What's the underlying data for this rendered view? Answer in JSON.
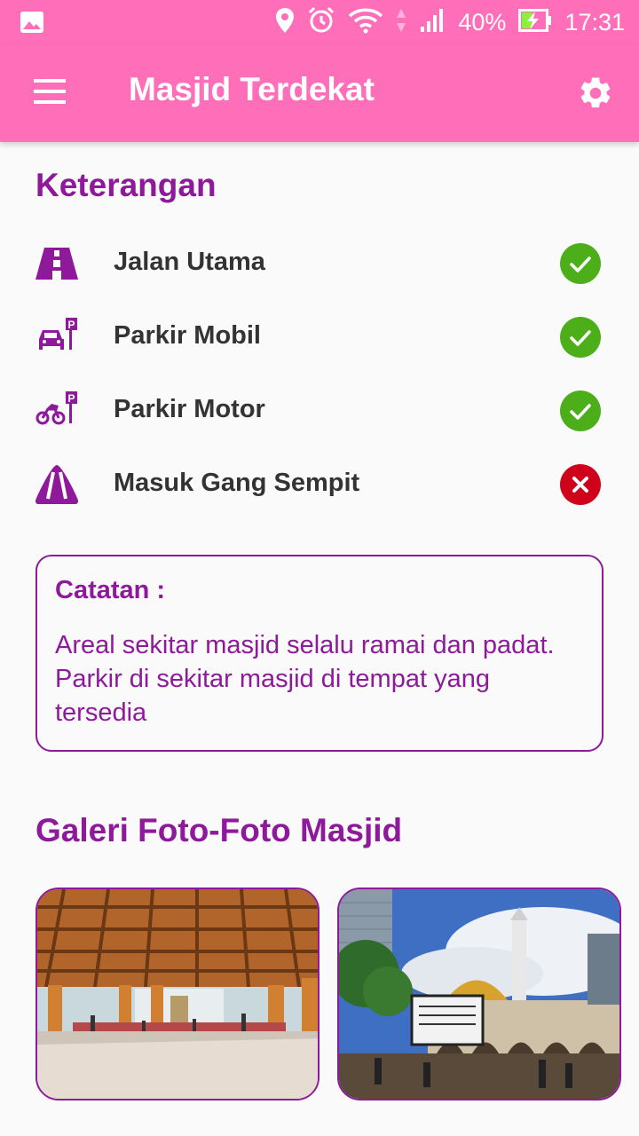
{
  "status_bar": {
    "battery": "40%",
    "time": "17:31"
  },
  "app_bar": {
    "title": "Masjid Terdekat",
    "menu_icon": "hamburger-menu-icon",
    "settings_icon": "gear-icon"
  },
  "info": {
    "heading": "Keterangan",
    "items": [
      {
        "label": "Jalan Utama",
        "icon": "main-road-icon",
        "available": true
      },
      {
        "label": "Parkir Mobil",
        "icon": "car-parking-icon",
        "available": true
      },
      {
        "label": "Parkir Motor",
        "icon": "motorcycle-parking-icon",
        "available": true
      },
      {
        "label": "Masuk Gang Sempit",
        "icon": "narrow-road-icon",
        "available": false
      }
    ]
  },
  "note": {
    "title": "Catatan :",
    "text": "Areal sekitar masjid selalu ramai dan padat. Parkir di sekitar masjid di tempat yang tersedia"
  },
  "gallery": {
    "heading": "Galeri Foto-Foto Masjid",
    "photos": [
      {
        "icon": "mosque-interior-photo"
      },
      {
        "icon": "mosque-exterior-photo"
      }
    ]
  },
  "colors": {
    "primary": "#ff6fb9",
    "accent": "#8e1a9b",
    "ok": "#4caf1a",
    "no": "#d0021b"
  }
}
